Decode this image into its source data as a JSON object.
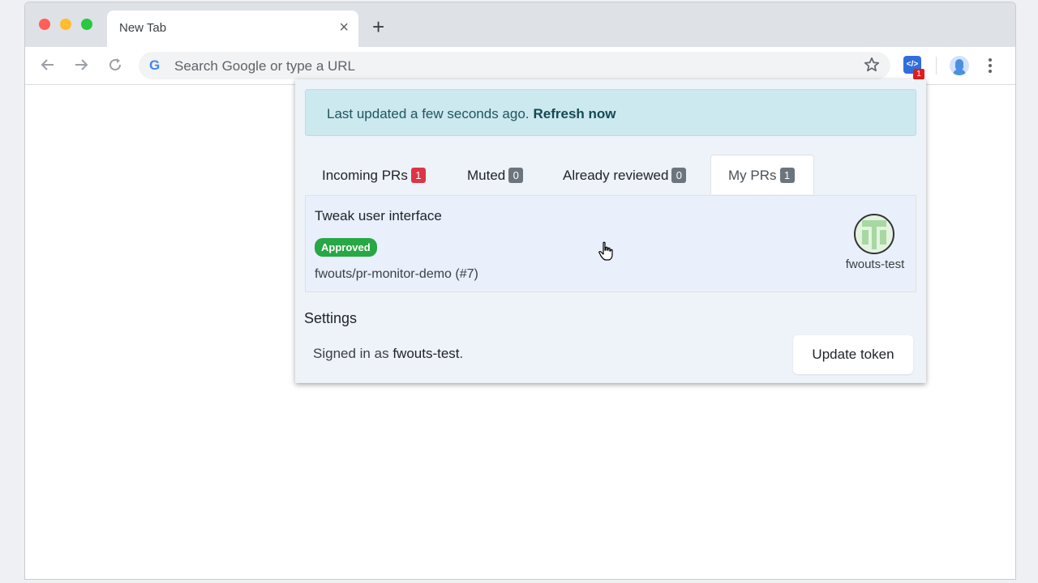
{
  "browser": {
    "tab_title": "New Tab",
    "tab_close_glyph": "×",
    "new_tab_glyph": "+",
    "omnibox_placeholder": "Search Google or type a URL",
    "extension_icon_text": "</>",
    "extension_badge": "1",
    "icons": {
      "back": "arrow-left-icon",
      "forward": "arrow-right-icon",
      "reload": "reload-icon",
      "bookmark": "star-icon",
      "menu": "kebab-menu-icon"
    },
    "colors": {
      "frame": "#dee1e6",
      "extension": "#2f6fdc",
      "badge": "#e01e1e"
    }
  },
  "popup": {
    "banner": {
      "text": "Last updated a few seconds ago.",
      "link": "Refresh now"
    },
    "tabs": [
      {
        "label": "Incoming PRs",
        "count": "1",
        "badge_color": "#dc3545",
        "active": false
      },
      {
        "label": "Muted",
        "count": "0",
        "badge_color": "#6c757d",
        "active": false
      },
      {
        "label": "Already reviewed",
        "count": "0",
        "badge_color": "#6c757d",
        "active": false
      },
      {
        "label": "My PRs",
        "count": "1",
        "badge_color": "#6c757d",
        "active": true
      }
    ],
    "pr": {
      "title": "Tweak user interface",
      "status": "Approved",
      "status_color": "#28a745",
      "repo": "fwouts/pr-monitor-demo (#7)",
      "author": "fwouts-test"
    },
    "settings": {
      "title": "Settings",
      "signed_in_prefix": "Signed in as",
      "user": "fwouts-test",
      "suffix": ".",
      "update_button": "Update token"
    }
  }
}
